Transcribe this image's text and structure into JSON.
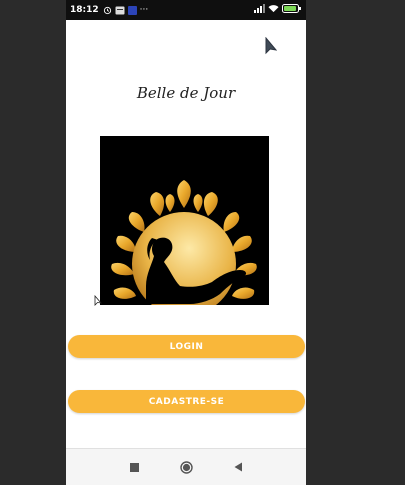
{
  "status_bar": {
    "time": "18:12",
    "notification_icons": [
      "alarm-icon",
      "notification-box-icon",
      "app-badge-icon"
    ],
    "more": "···",
    "right_icons": [
      "signal-icon",
      "wifi-icon",
      "battery-icon"
    ]
  },
  "app": {
    "title": "Belle de Jour"
  },
  "buttons": {
    "login_label": "LOGIN",
    "register_label": "CADASTRE-SE"
  },
  "colors": {
    "button": "#f9b73a",
    "logo_gold": "#e9a82b",
    "status_bar": "#0f0f0f"
  },
  "nav": {
    "icons": [
      "recents-square-icon",
      "home-circle-icon",
      "back-triangle-icon"
    ]
  }
}
